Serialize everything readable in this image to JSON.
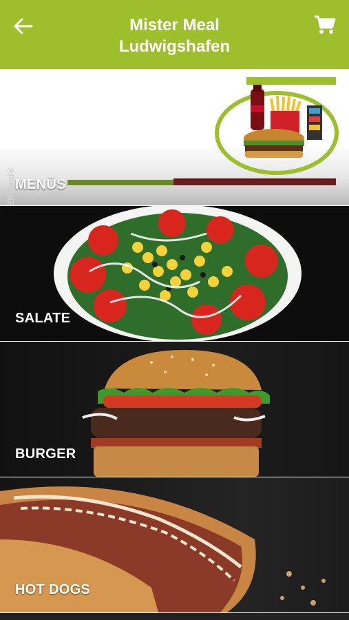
{
  "header": {
    "title_line1": "Mister Meal",
    "title_line2": "Ludwigshafen",
    "back_icon": "arrow-left-icon",
    "cart_icon": "shopping-cart-icon",
    "background_color": "#9cbf2b"
  },
  "categories": [
    {
      "label": "MENÜS",
      "image": "menu-combo-image"
    },
    {
      "label": "SALATE",
      "image": "salad-bowl-image"
    },
    {
      "label": "BURGER",
      "image": "burger-image"
    },
    {
      "label": "HOT DOGS",
      "image": "hot-dog-image"
    }
  ],
  "menus_brand": "MISTERMeal®"
}
